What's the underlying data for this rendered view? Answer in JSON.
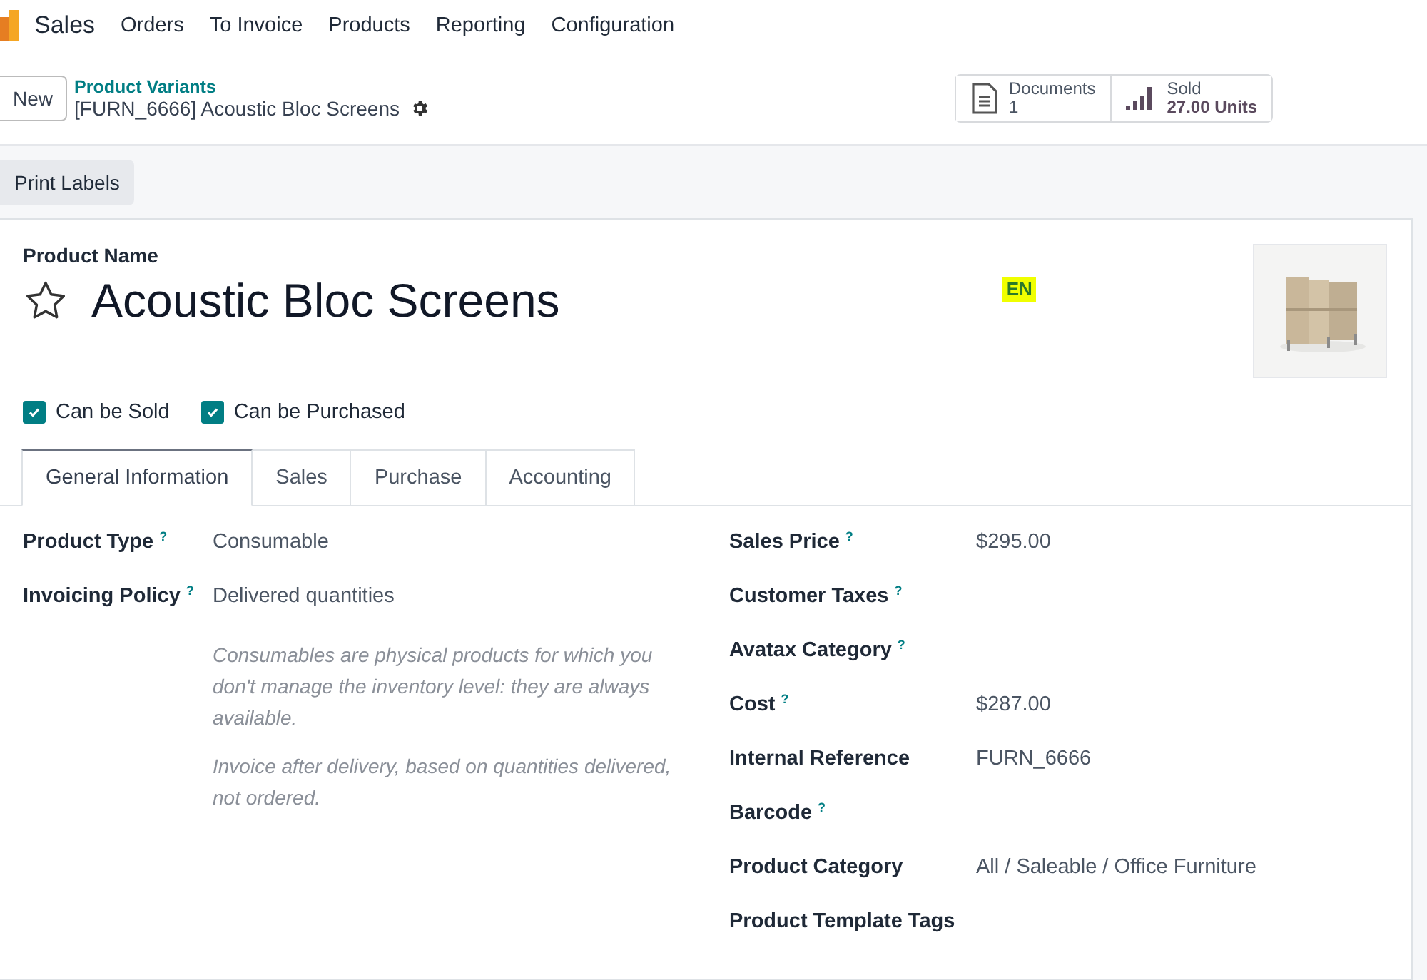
{
  "navbar": {
    "app": "Sales",
    "menu": [
      "Orders",
      "To Invoice",
      "Products",
      "Reporting",
      "Configuration"
    ]
  },
  "control_bar": {
    "new_button": "New",
    "breadcrumb": "Product Variants",
    "record": "[FURN_6666] Acoustic Bloc Screens",
    "stats": [
      {
        "kind": "document",
        "label": "Documents",
        "value": "1"
      },
      {
        "kind": "chart",
        "label": "Sold",
        "value": "27.00 Units"
      }
    ]
  },
  "actions": [
    "Print Labels"
  ],
  "form": {
    "name_label": "Product Name",
    "name": "Acoustic Bloc Screens",
    "favorite": false,
    "language": "EN",
    "options": [
      {
        "label": "Can be Sold",
        "checked": true
      },
      {
        "label": "Can be Purchased",
        "checked": true
      }
    ],
    "tabs": [
      {
        "label": "General Information",
        "selected": true
      },
      {
        "label": "Sales",
        "selected": false
      },
      {
        "label": "Purchase",
        "selected": false
      },
      {
        "label": "Accounting",
        "selected": false
      }
    ],
    "left_fields": [
      {
        "label": "Product Type",
        "help": "?",
        "value": "Consumable"
      },
      {
        "label": "Invoicing Policy",
        "help": "?",
        "value": "Delivered quantities"
      }
    ],
    "notes": [
      "Consumables are physical products for which you don't manage the inventory level: they are always available.",
      "Invoice after delivery, based on quantities delivered, not ordered."
    ],
    "right_fields": [
      {
        "label": "Sales Price",
        "help": "?",
        "value": "$295.00"
      },
      {
        "label": "Customer Taxes",
        "help": "?"
      },
      {
        "label": "Avatax Category",
        "help": "?"
      },
      {
        "label": "Cost",
        "help": "?",
        "value": "$287.00"
      },
      {
        "label": "Internal Reference",
        "value": "FURN_6666"
      },
      {
        "label": "Barcode",
        "help": "?"
      },
      {
        "label": "Product Category",
        "value": "All / Saleable / Office Furniture"
      },
      {
        "label": "Product Template Tags"
      }
    ]
  }
}
